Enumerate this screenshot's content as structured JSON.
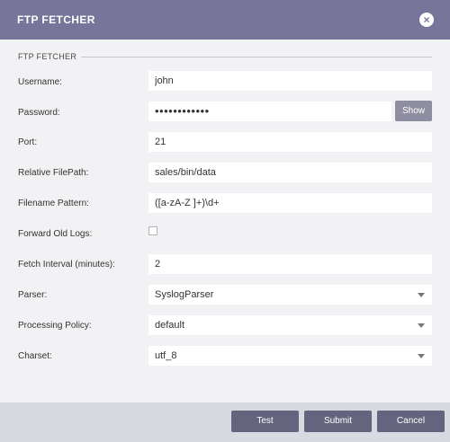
{
  "dialog": {
    "title": "FTP FETCHER",
    "section": "FTP FETCHER"
  },
  "fields": {
    "username": {
      "label": "Username:",
      "value": "john"
    },
    "password": {
      "label": "Password:",
      "value": "••••••••••••",
      "show_label": "Show"
    },
    "port": {
      "label": "Port:",
      "value": "21"
    },
    "relative_filepath": {
      "label": "Relative FilePath:",
      "value": "sales/bin/data"
    },
    "filename_pattern": {
      "label": "Filename Pattern:",
      "value": "([a-zA-Z ]+)\\d+"
    },
    "forward_old_logs": {
      "label": "Forward Old Logs:",
      "checked": false
    },
    "fetch_interval": {
      "label": "Fetch Interval (minutes):",
      "value": "2"
    },
    "parser": {
      "label": "Parser:",
      "value": "SyslogParser"
    },
    "processing_policy": {
      "label": "Processing Policy:",
      "value": "default"
    },
    "charset": {
      "label": "Charset:",
      "value": "utf_8"
    }
  },
  "buttons": {
    "test": "Test",
    "submit": "Submit",
    "cancel": "Cancel"
  },
  "colors": {
    "titlebar": "#77759a",
    "button": "#65647f",
    "show_button": "#8e8ea0",
    "footer": "#d9d9e1",
    "body": "#f2f2f4"
  },
  "icons": {
    "close": "close-circle-icon",
    "dropdown": "caret-down-icon"
  }
}
